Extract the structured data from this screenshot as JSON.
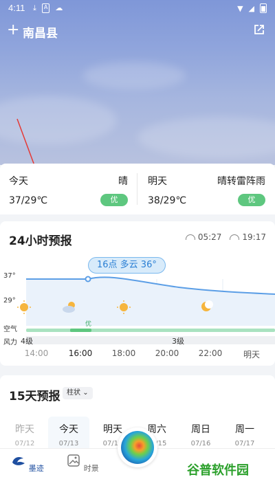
{
  "status_bar": {
    "time": "4:11",
    "left_icons": [
      "download-icon",
      "a-icon",
      "cloud-icon"
    ],
    "right_icons": [
      "wifi-icon",
      "signal-icon",
      "battery-icon"
    ]
  },
  "header": {
    "add_symbol": "+",
    "city": "南昌县"
  },
  "today": {
    "label": "今天",
    "condition": "晴",
    "temp": "37/29℃",
    "aqi": "优"
  },
  "tomorrow": {
    "label": "明天",
    "condition": "晴转雷阵雨",
    "temp": "38/29℃",
    "aqi": "优"
  },
  "forecast24": {
    "title": "24小时预报",
    "sunrise": "05:27",
    "sunset": "19:17",
    "bubble": "16点 多云 36°",
    "y_ticks": [
      "37°",
      "29°"
    ],
    "air_label": "空气",
    "air_badge": "优",
    "wind_label": "风力",
    "wind_levels": [
      "4级",
      "3级"
    ],
    "times": [
      "14:00",
      "16:00",
      "18:00",
      "20:00",
      "22:00",
      "明天"
    ],
    "icons": [
      "sun-icon",
      "cloud-sun-icon",
      "sun-icon",
      "moon-icon"
    ],
    "colors": {
      "line": "#5b9ee6",
      "fill": "#dbe9f8",
      "air": "#a9e2c0",
      "air_active": "#5ec77f"
    }
  },
  "forecast15": {
    "title": "15天预报",
    "mode": "柱状",
    "days": [
      {
        "day": "昨天",
        "date": "07/12"
      },
      {
        "day": "今天",
        "date": "07/13"
      },
      {
        "day": "明天",
        "date": "07/14"
      },
      {
        "day": "周六",
        "date": "07/15"
      },
      {
        "day": "周日",
        "date": "07/16"
      },
      {
        "day": "周一",
        "date": "07/17"
      }
    ]
  },
  "nav": {
    "items": [
      "墨迹",
      "时景"
    ]
  },
  "watermark": "谷普软件园"
}
